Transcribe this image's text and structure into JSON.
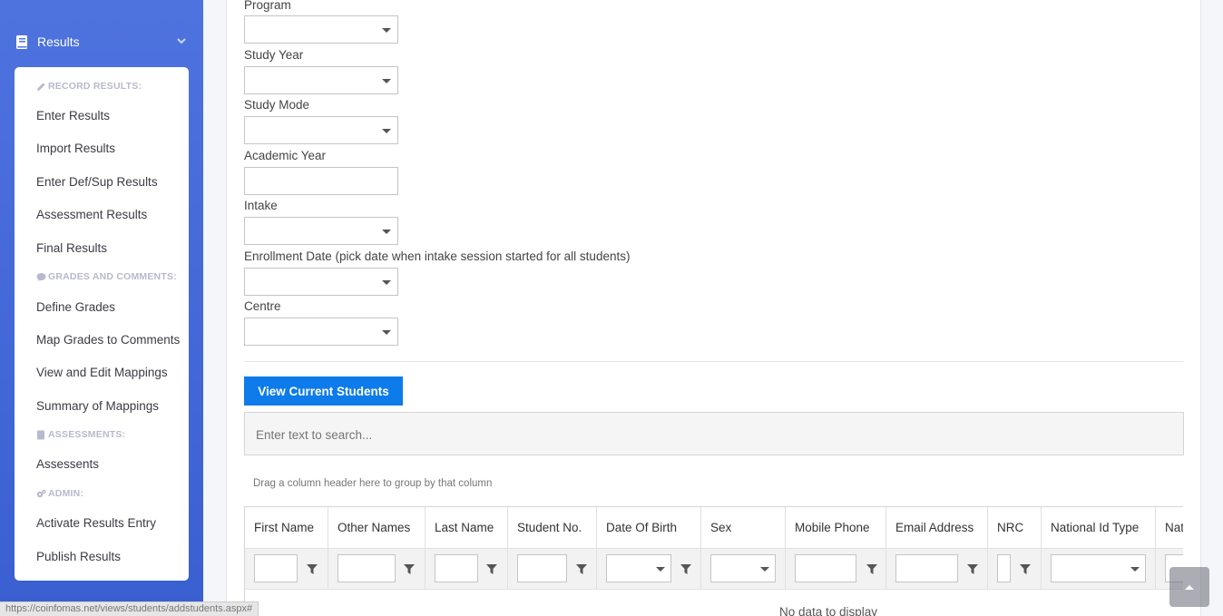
{
  "sidebar": {
    "section_label": "Results",
    "groups": [
      {
        "header": "RECORD RESULTS:",
        "icon": "pencil-icon"
      },
      {
        "header": "GRADES AND COMMENTS:",
        "icon": "comment-icon"
      },
      {
        "header": "ASSESSMENTS:",
        "icon": "book-icon"
      },
      {
        "header": "ADMIN:",
        "icon": "gears-icon"
      }
    ],
    "items": [
      "Enter Results",
      "Import Results",
      "Enter Def/Sup Results",
      "Assessment Results",
      "Final Results",
      "Define Grades",
      "Map Grades to Comments",
      "View and Edit Mappings",
      "Summary of Mappings",
      "Assessents",
      "Activate Results Entry",
      "Publish Results"
    ]
  },
  "status_url": "https://coinfomas.net/views/students/addstudents.aspx#",
  "form": {
    "program_label": "Program",
    "study_year_label": "Study Year",
    "study_mode_label": "Study Mode",
    "academic_year_label": "Academic Year",
    "intake_label": "Intake",
    "enrollment_label": "Enrollment Date (pick date when intake session started for all students)",
    "centre_label": "Centre"
  },
  "view_button_label": "View Current Students",
  "search": {
    "placeholder": "Enter text to search..."
  },
  "grid": {
    "group_panel_text": "Drag a column header here to group by that column",
    "columns": [
      "First Name",
      "Other Names",
      "Last Name",
      "Student No.",
      "Date Of Birth",
      "Sex",
      "Mobile Phone",
      "Email Address",
      "NRC",
      "National Id Type",
      "Nati"
    ],
    "empty_text": "No data to display"
  },
  "colors": {
    "sidebar": "#4e73df",
    "primary_button": "#0d7bea"
  }
}
